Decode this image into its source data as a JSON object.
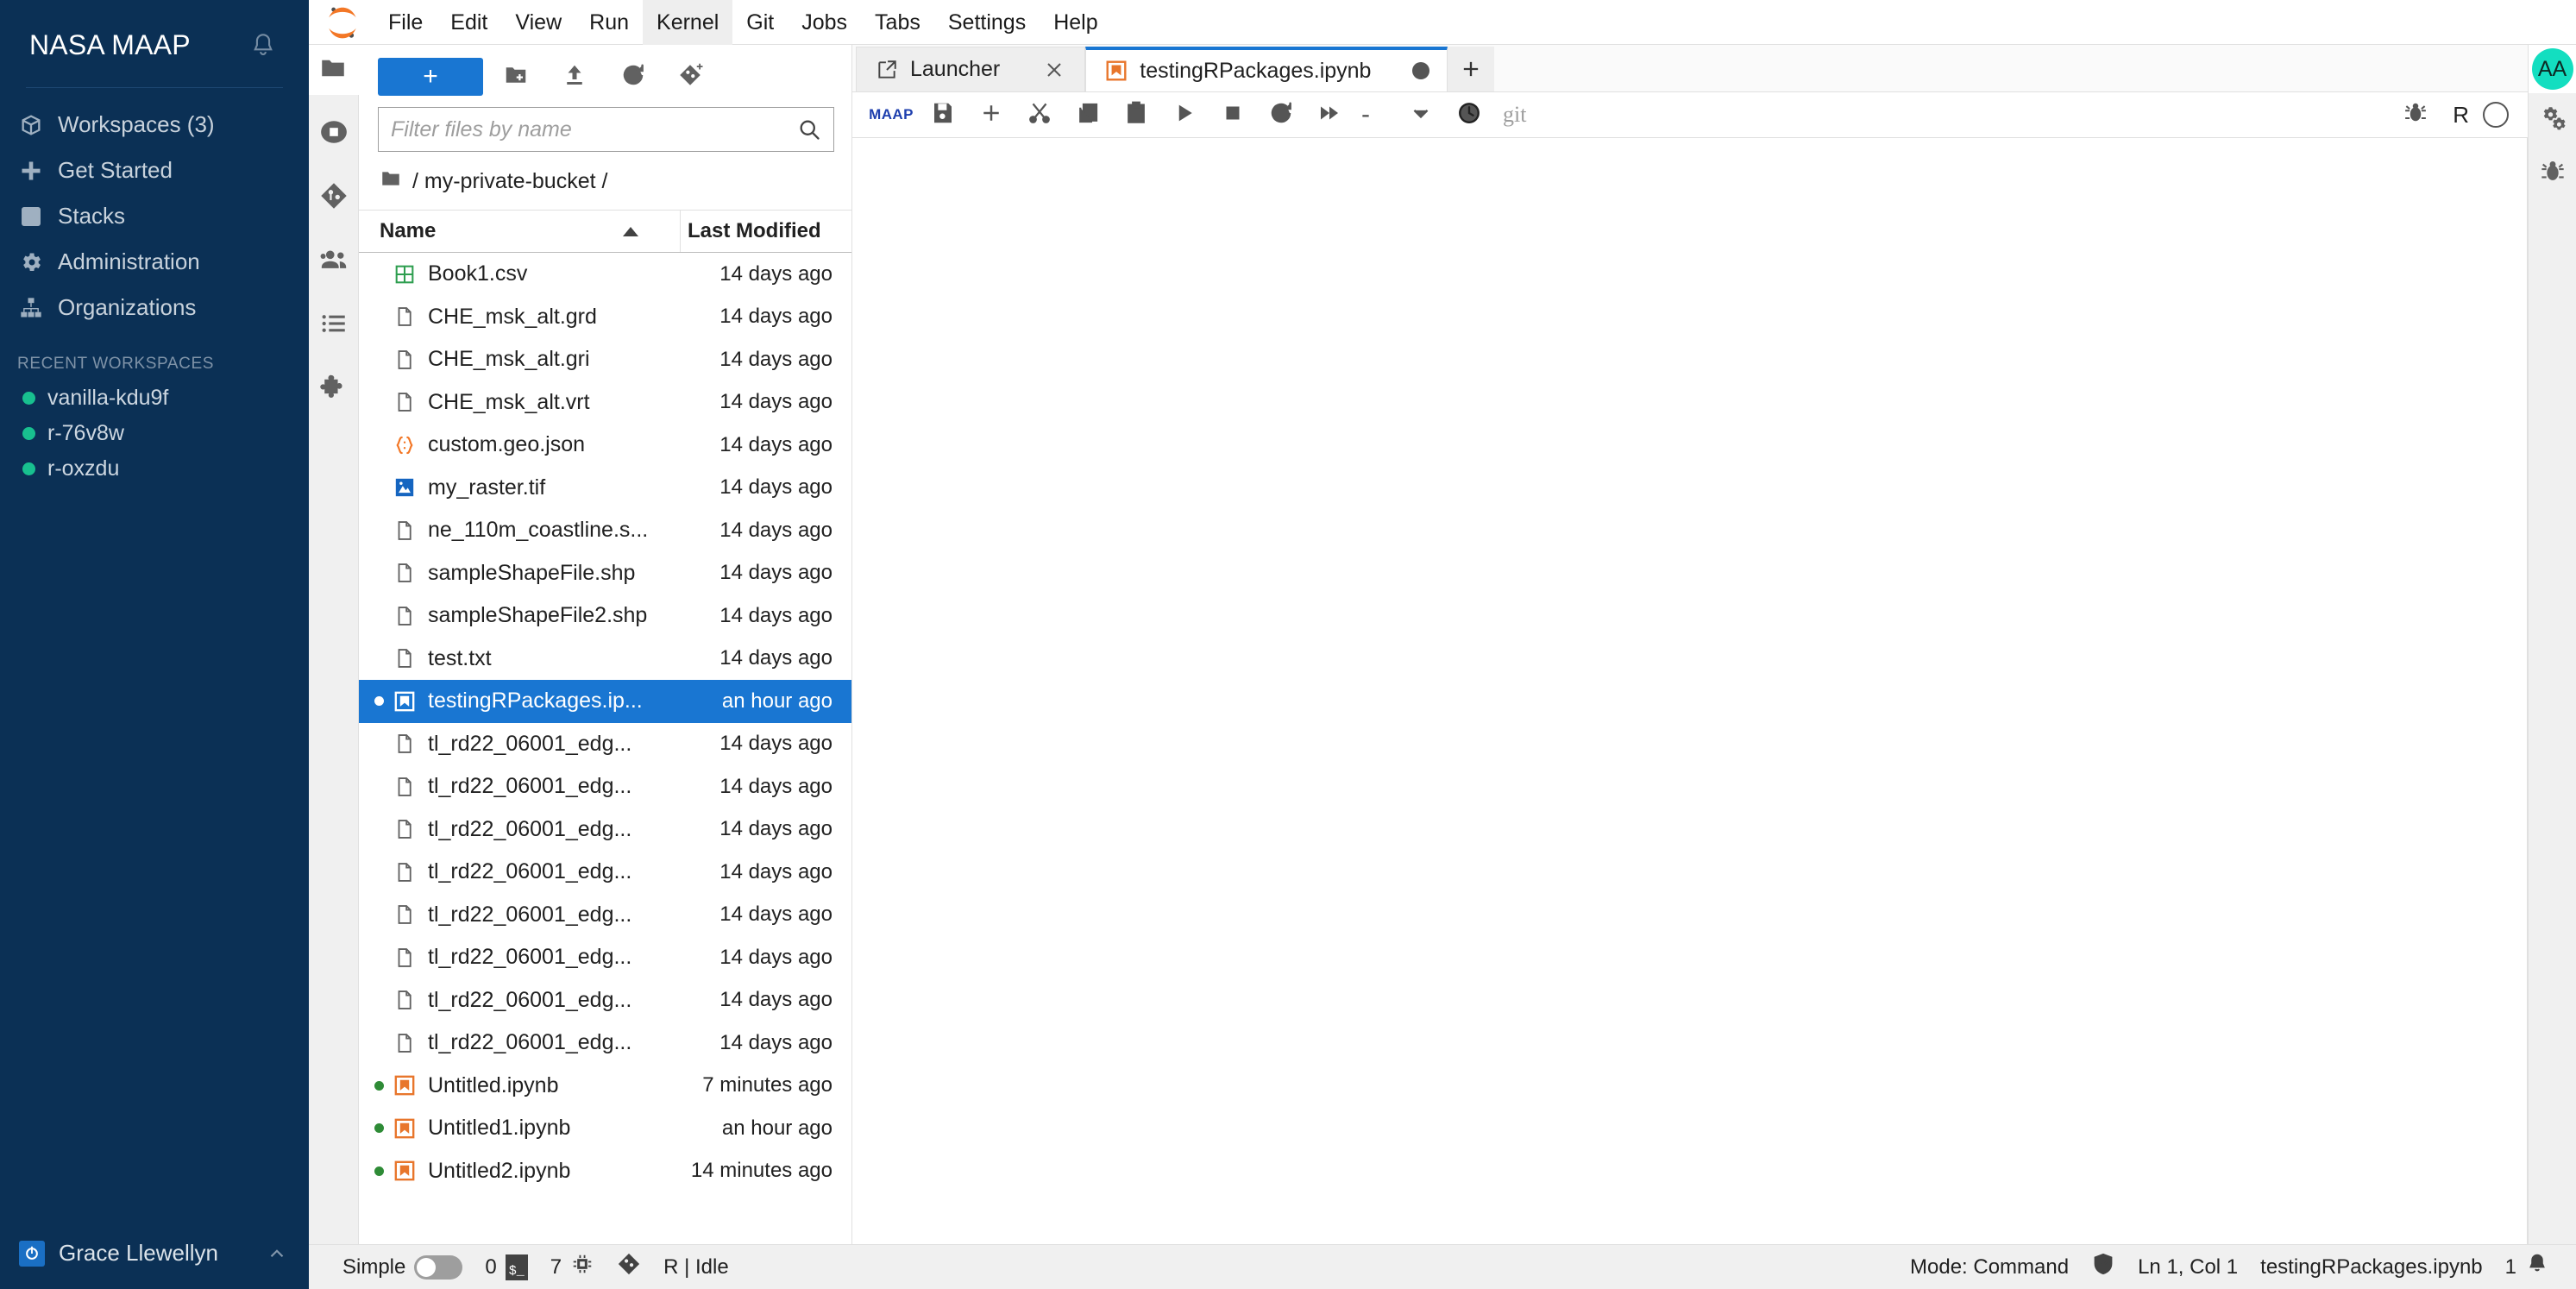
{
  "maap": {
    "brand_title": "NASA MAAP",
    "bell_icon": "bell-icon",
    "nav": [
      {
        "label": "Workspaces (3)",
        "icon": "cube-icon",
        "name": "workspaces"
      },
      {
        "label": "Get Started",
        "icon": "plus-icon",
        "name": "get-started"
      },
      {
        "label": "Stacks",
        "icon": "stacks-icon",
        "name": "stacks"
      },
      {
        "label": "Administration",
        "icon": "gear-icon",
        "name": "administration"
      },
      {
        "label": "Organizations",
        "icon": "org-chart-icon",
        "name": "organizations"
      }
    ],
    "recent_label": "RECENT WORKSPACES",
    "recent": [
      {
        "label": "vanilla-kdu9f",
        "status_color": "#18c08f"
      },
      {
        "label": "r-76v8w",
        "status_color": "#18c08f"
      },
      {
        "label": "r-oxzdu",
        "status_color": "#18c08f"
      }
    ],
    "user_name": "Grace Llewellyn",
    "user_icon": "power-icon",
    "collapse_icon": "chevron-up-icon"
  },
  "menubar": {
    "logo": "jupyter-logo-icon",
    "items": [
      {
        "label": "File",
        "active": false
      },
      {
        "label": "Edit",
        "active": false
      },
      {
        "label": "View",
        "active": false
      },
      {
        "label": "Run",
        "active": false
      },
      {
        "label": "Kernel",
        "active": true
      },
      {
        "label": "Git",
        "active": false
      },
      {
        "label": "Jobs",
        "active": false
      },
      {
        "label": "Tabs",
        "active": false
      },
      {
        "label": "Settings",
        "active": false
      },
      {
        "label": "Help",
        "active": false
      }
    ]
  },
  "activitybar": [
    {
      "name": "file-browser",
      "icon": "folder-icon",
      "selected": true
    },
    {
      "name": "running-terminals",
      "icon": "stop-circle-icon",
      "selected": false
    },
    {
      "name": "git",
      "icon": "git-icon",
      "selected": false
    },
    {
      "name": "collaboration",
      "icon": "users-icon",
      "selected": false
    },
    {
      "name": "table-of-contents",
      "icon": "list-icon",
      "selected": false
    },
    {
      "name": "extension-manager",
      "icon": "puzzle-icon",
      "selected": false
    }
  ],
  "filebrowser": {
    "new_button_label": "+",
    "tools": [
      {
        "name": "new-folder",
        "icon": "new-folder-icon"
      },
      {
        "name": "upload-files",
        "icon": "upload-icon"
      },
      {
        "name": "refresh-file-list",
        "icon": "refresh-icon"
      },
      {
        "name": "new-git-repo",
        "icon": "git-plus-icon"
      }
    ],
    "filter_placeholder": "Filter files by name",
    "filter_value": "",
    "search_icon": "search-icon",
    "breadcrumb": "/ my-private-bucket /",
    "breadcrumb_icon": "folder-icon",
    "columns": {
      "name": "Name",
      "last_modified": "Last Modified"
    },
    "sort_direction": "ascending",
    "files": [
      {
        "name": "Book1.csv",
        "modified": "14 days ago",
        "icon": "csv-icon",
        "dot": "none",
        "selected": false
      },
      {
        "name": "CHE_msk_alt.grd",
        "modified": "14 days ago",
        "icon": "file-icon",
        "dot": "none",
        "selected": false
      },
      {
        "name": "CHE_msk_alt.gri",
        "modified": "14 days ago",
        "icon": "file-icon",
        "dot": "none",
        "selected": false
      },
      {
        "name": "CHE_msk_alt.vrt",
        "modified": "14 days ago",
        "icon": "file-icon",
        "dot": "none",
        "selected": false
      },
      {
        "name": "custom.geo.json",
        "modified": "14 days ago",
        "icon": "json-icon",
        "dot": "none",
        "selected": false
      },
      {
        "name": "my_raster.tif",
        "modified": "14 days ago",
        "icon": "image-icon",
        "dot": "none",
        "selected": false
      },
      {
        "name": "ne_110m_coastline.s...",
        "modified": "14 days ago",
        "icon": "file-icon",
        "dot": "none",
        "selected": false
      },
      {
        "name": "sampleShapeFile.shp",
        "modified": "14 days ago",
        "icon": "file-icon",
        "dot": "none",
        "selected": false
      },
      {
        "name": "sampleShapeFile2.shp",
        "modified": "14 days ago",
        "icon": "file-icon",
        "dot": "none",
        "selected": false
      },
      {
        "name": "test.txt",
        "modified": "14 days ago",
        "icon": "file-icon",
        "dot": "none",
        "selected": false
      },
      {
        "name": "testingRPackages.ip...",
        "modified": "an hour ago",
        "icon": "notebook-icon",
        "dot": "white",
        "selected": true
      },
      {
        "name": "tl_rd22_06001_edg...",
        "modified": "14 days ago",
        "icon": "file-icon",
        "dot": "none",
        "selected": false
      },
      {
        "name": "tl_rd22_06001_edg...",
        "modified": "14 days ago",
        "icon": "file-icon",
        "dot": "none",
        "selected": false
      },
      {
        "name": "tl_rd22_06001_edg...",
        "modified": "14 days ago",
        "icon": "file-icon",
        "dot": "none",
        "selected": false
      },
      {
        "name": "tl_rd22_06001_edg...",
        "modified": "14 days ago",
        "icon": "file-icon",
        "dot": "none",
        "selected": false
      },
      {
        "name": "tl_rd22_06001_edg...",
        "modified": "14 days ago",
        "icon": "file-icon",
        "dot": "none",
        "selected": false
      },
      {
        "name": "tl_rd22_06001_edg...",
        "modified": "14 days ago",
        "icon": "file-icon",
        "dot": "none",
        "selected": false
      },
      {
        "name": "tl_rd22_06001_edg...",
        "modified": "14 days ago",
        "icon": "file-icon",
        "dot": "none",
        "selected": false
      },
      {
        "name": "tl_rd22_06001_edg...",
        "modified": "14 days ago",
        "icon": "file-icon",
        "dot": "none",
        "selected": false
      },
      {
        "name": "Untitled.ipynb",
        "modified": "7 minutes ago",
        "icon": "notebook-icon",
        "dot": "green",
        "selected": false
      },
      {
        "name": "Untitled1.ipynb",
        "modified": "an hour ago",
        "icon": "notebook-icon",
        "dot": "green",
        "selected": false
      },
      {
        "name": "Untitled2.ipynb",
        "modified": "14 minutes ago",
        "icon": "notebook-icon",
        "dot": "green",
        "selected": false
      }
    ]
  },
  "dock": {
    "tabs": [
      {
        "label": "Launcher",
        "icon": "launcher-icon",
        "current": false,
        "closable": true,
        "dirty": false
      },
      {
        "label": "testingRPackages.ipynb",
        "icon": "notebook-icon",
        "current": true,
        "closable": false,
        "dirty": true
      }
    ],
    "add_tab_icon": "plus-icon"
  },
  "notebook_toolbar": {
    "maap_label": "MAAP",
    "buttons": [
      {
        "name": "save",
        "icon": "save-icon"
      },
      {
        "name": "insert-cell",
        "icon": "plus-icon"
      },
      {
        "name": "cut-cells",
        "icon": "scissors-icon"
      },
      {
        "name": "copy-cells",
        "icon": "copy-icon"
      },
      {
        "name": "paste-cells",
        "icon": "paste-icon"
      },
      {
        "name": "run-cell",
        "icon": "play-icon"
      },
      {
        "name": "interrupt-kernel",
        "icon": "stop-icon"
      },
      {
        "name": "restart-kernel",
        "icon": "restart-icon"
      },
      {
        "name": "restart-and-run-all",
        "icon": "fast-forward-icon"
      }
    ],
    "cell_type": "-",
    "cell_type_caret": "chevron-down-icon",
    "history_icon": "clock-icon",
    "git_label": "git",
    "debug_icon": "bug-icon",
    "kernel_name": "R",
    "kernel_status": "idle"
  },
  "right_bar": {
    "avatar_initials": "AA",
    "avatar_color": "#13dec0",
    "buttons": [
      {
        "name": "property-inspector",
        "icon": "gears-icon"
      },
      {
        "name": "debugger",
        "icon": "bug-icon"
      }
    ]
  },
  "statusbar": {
    "simple_label": "Simple",
    "simple_enabled": false,
    "terminal_count": "0",
    "terminal_icon": "terminal-icon",
    "kernel_count": "7",
    "kernel_icon": "chip-icon",
    "git_icon": "git-icon",
    "kernel_status_text": "R | Idle",
    "mode_text": "Mode: Command",
    "trust_icon": "shield-check-icon",
    "cursor_position": "Ln 1, Col 1",
    "file_name": "testingRPackages.ipynb",
    "notification_count": "1",
    "notification_icon": "bell-icon"
  },
  "colors": {
    "brand_navy": "#0b3055",
    "accent_blue": "#1976d2",
    "selection_blue": "#1976d2",
    "status_green": "#18c08f",
    "notebook_orange": "#e8762c",
    "avatar_teal": "#13dec0"
  }
}
